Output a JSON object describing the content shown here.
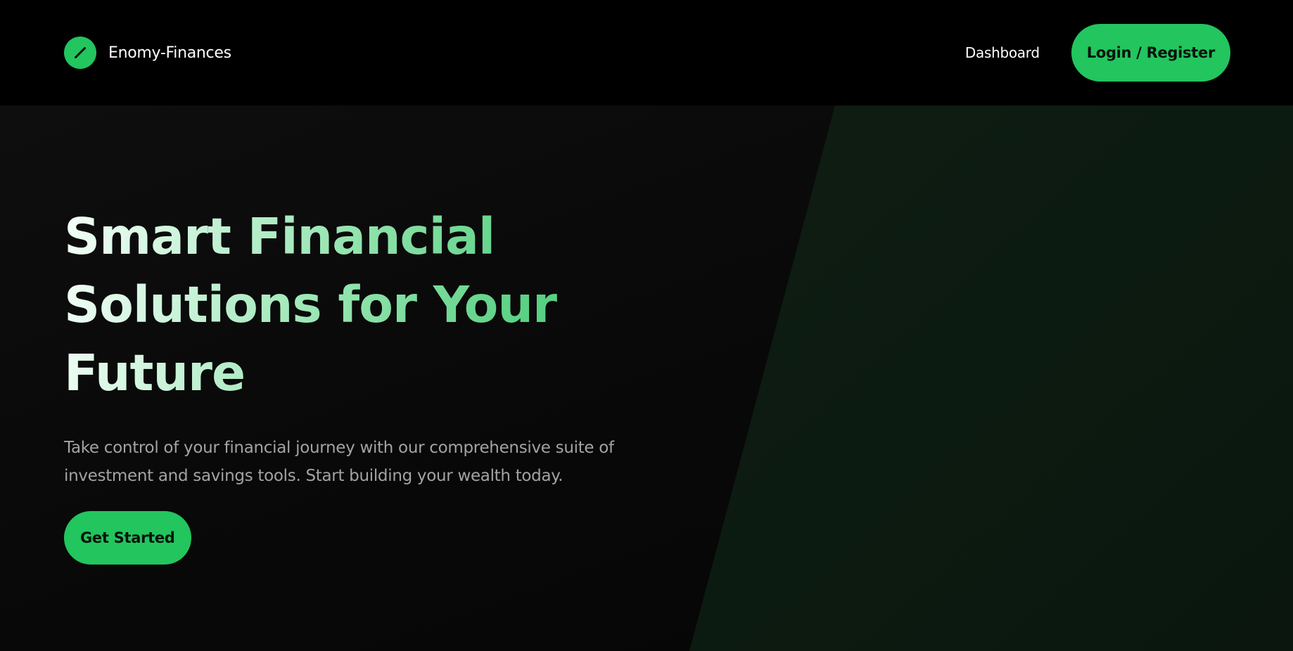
{
  "header": {
    "brand_name": "Enomy-Finances",
    "logo_icon": "slash-icon",
    "nav_dashboard": "Dashboard",
    "login_label": "Login / Register"
  },
  "hero": {
    "title_lines": [
      "Smart Financial",
      "Solutions for Your",
      "Future"
    ],
    "subtitle": "Take control of your financial journey with our comprehensive suite of investment and savings tools. Start building your wealth today.",
    "cta_label": "Get Started"
  },
  "colors": {
    "accent": "#22c55e",
    "background": "#000000",
    "subtitle_text": "#a3a3a3"
  }
}
